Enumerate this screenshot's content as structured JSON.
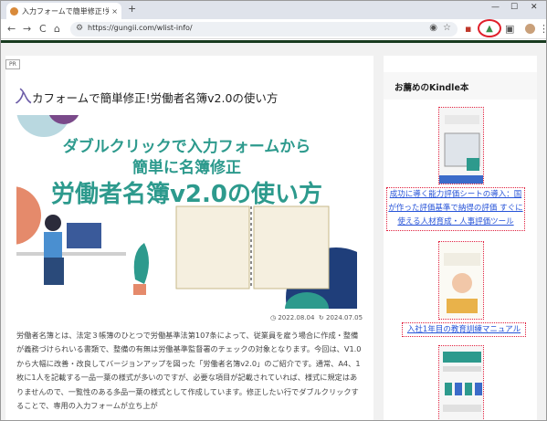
{
  "browser": {
    "tab_title": "入力フォームで簡単修正!労働者名",
    "tab_close": "×",
    "new_tab": "+",
    "url": "https://gungii.com/wlist-info/",
    "min": "—",
    "max": "☐",
    "close": "✕",
    "back": "←",
    "forward": "→",
    "reload": "C",
    "home": "⌂"
  },
  "article": {
    "pr_badge": "PR",
    "title_first": "入",
    "title_rest": "カフォームで簡単修正!労働者名簿v2.0の使い方",
    "hero": {
      "line1": "ダブルクリックで入力フォームから",
      "line2": "簡単に名簿修正",
      "line3": "労働者名簿v2.0の使い方"
    },
    "date_published": "2022.08.04",
    "date_updated": "2024.07.05",
    "body": "労働者名簿とは、法定３帳簿のひとつで労働基準法第107条によって、従業員を雇う場合に作成・整備が義務づけられいる書類で、整備の有無は労働基準監督署のチェックの対象となります。今回は、V1.0から大幅に改善・改良してバージョンアップを図った「労働者名簿v2.0」のご紹介です。通常、A4、1枚に1人を記載する一品一葉の様式が多いのですが、必要な項目が記載されていれば、様式に規定はありませんので、一覧性のある多品一葉の様式として作成しています。修正したい行でダブルクリックすることで、専用の入力フォームが立ち上が"
  },
  "sidebar": {
    "heading": "お薦めのKindle本",
    "books": [
      {
        "link_text": "成功に導く能力評価シートの導入：国が作った評価基準で納得の評価 すぐに使える人材育成・人事評価ツール"
      },
      {
        "link_text": "入社1年目の教育訓練マニュアル"
      }
    ]
  },
  "colors": {
    "accent_teal": "#2d9a8d",
    "title_purple": "#6a5aa6",
    "link_blue": "#2653d8",
    "highlight_red": "#e0202b",
    "header_green": "#173a1e"
  }
}
